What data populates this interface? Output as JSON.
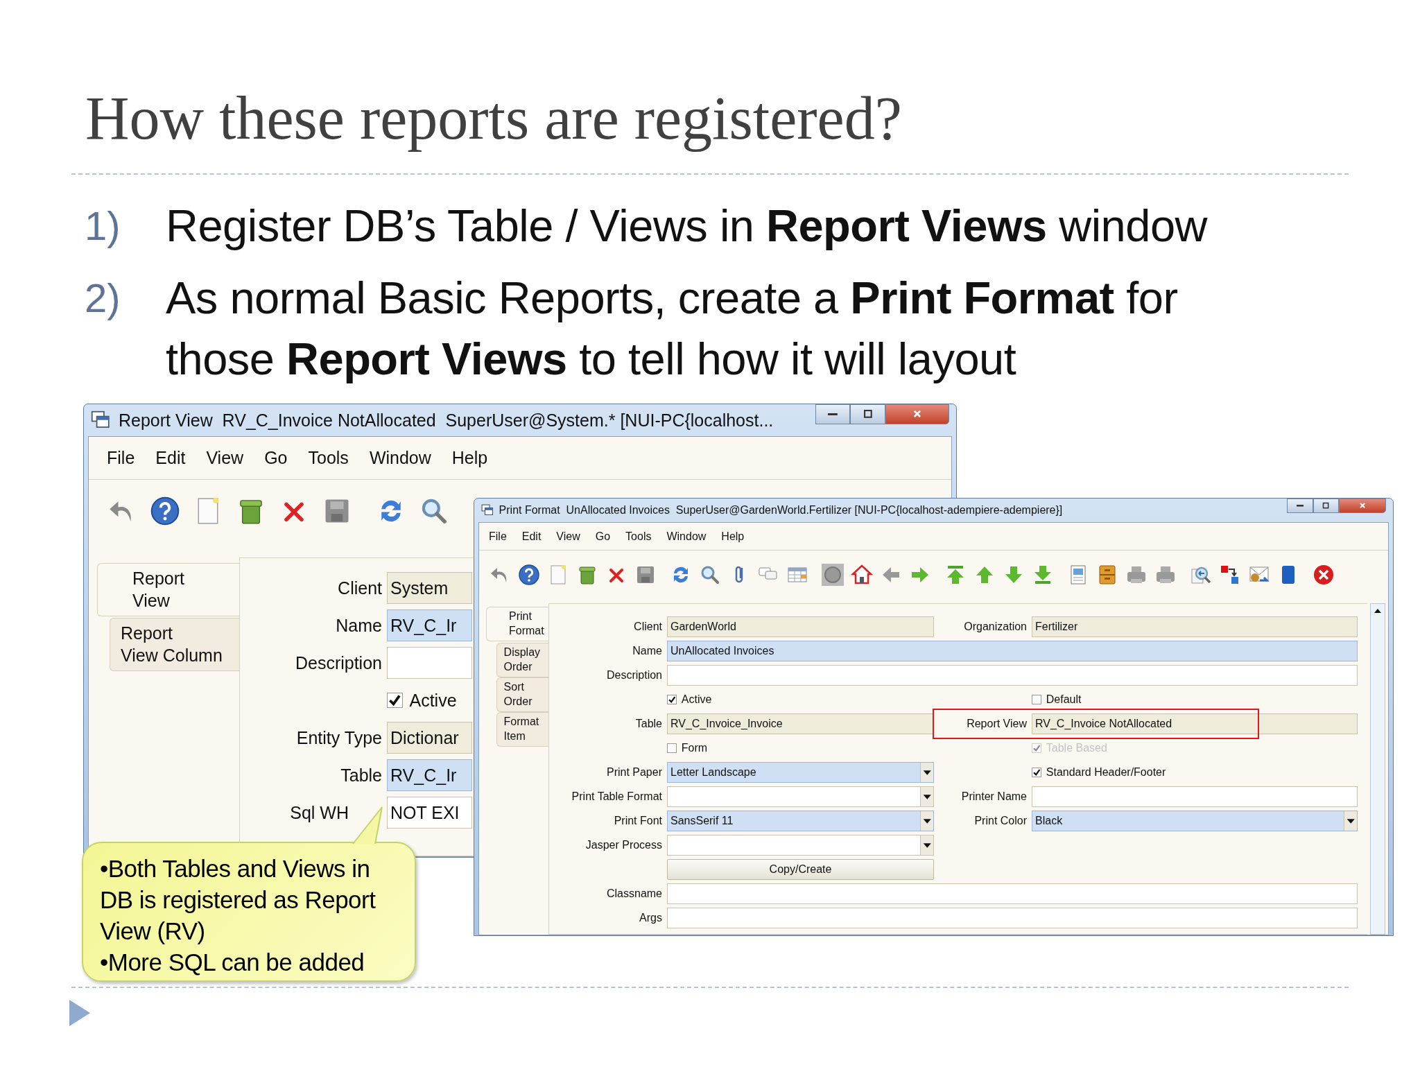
{
  "slide": {
    "title": "How these reports are registered?",
    "points": [
      {
        "number": "1)",
        "text": "Register DB’s Table / Views in **Report Views** window"
      },
      {
        "number": "2)",
        "text": "As normal Basic Reports, create a **Print Format** for those **Report Views** to tell how it will layout"
      }
    ]
  },
  "windows": [
    {
      "title": "Report View  RV_C_Invoice NotAllocated  SuperUser@System.* [NUI-PC{localhost...",
      "menu": [
        "File",
        "Edit",
        "View",
        "Go",
        "Tools",
        "Window",
        "Help"
      ],
      "tabs": [
        {
          "label": "Report\nView",
          "selected": true
        },
        {
          "label": "Report\nView Column",
          "selected": false
        }
      ],
      "rows": [
        [
          {
            "kind": "text",
            "label": "Client",
            "value": "System",
            "readonly": true,
            "mandatory": false
          }
        ],
        [
          {
            "kind": "text",
            "label": "Name",
            "value": "RV_C_Ir",
            "readonly": false,
            "mandatory": true
          }
        ],
        [
          {
            "kind": "text",
            "label": "Description",
            "readonly": false,
            "mandatory": false
          }
        ],
        [
          {
            "kind": "checkbox",
            "label": "Active",
            "checked": true,
            "disabled": false
          }
        ],
        [
          {
            "kind": "text",
            "label": "Entity Type",
            "value": "Dictionar",
            "readonly": true,
            "mandatory": false
          }
        ],
        [
          {
            "kind": "text",
            "label": "Table",
            "value": "RV_C_Ir",
            "readonly": false,
            "mandatory": true
          }
        ],
        [
          {
            "kind": "text",
            "label": "Sql WH",
            "value": "NOT EXI",
            "readonly": false,
            "mandatory": false
          }
        ]
      ]
    },
    {
      "title": "Print Format  UnAllocated Invoices  SuperUser@GardenWorld.Fertilizer [NUI-PC{localhost-adempiere-adempiere}]",
      "menu": [
        "File",
        "Edit",
        "View",
        "Go",
        "Tools",
        "Window",
        "Help"
      ],
      "tabs": [
        {
          "label": "Print\nFormat",
          "selected": true
        },
        {
          "label": "Display\nOrder",
          "selected": false
        },
        {
          "label": "Sort\nOrder",
          "selected": false
        },
        {
          "label": "Format\nItem",
          "selected": false
        }
      ],
      "rows": [
        [
          {
            "kind": "text",
            "label": "Client",
            "value": "GardenWorld",
            "readonly": true,
            "mandatory": false
          },
          {
            "kind": "text",
            "label": "Organization",
            "value": "Fertilizer",
            "readonly": true,
            "mandatory": false
          }
        ],
        [
          {
            "kind": "text",
            "label": "Name",
            "value": "UnAllocated Invoices",
            "readonly": false,
            "mandatory": true,
            "wide": true
          }
        ],
        [
          {
            "kind": "text",
            "label": "Description",
            "readonly": false,
            "mandatory": false,
            "wide": true
          }
        ],
        [
          {
            "kind": "checkbox",
            "label": "Active",
            "checked": true,
            "disabled": false
          },
          {
            "kind": "checkbox",
            "label": "Default",
            "checked": false,
            "disabled": false
          }
        ],
        [
          {
            "kind": "text",
            "label": "Table",
            "value": "RV_C_Invoice_Invoice",
            "readonly": true,
            "mandatory": false
          },
          {
            "kind": "text",
            "label": "Report View",
            "value": "RV_C_Invoice NotAllocated",
            "readonly": true,
            "mandatory": false,
            "highlighted": true
          }
        ],
        [
          {
            "kind": "checkbox",
            "label": "Form",
            "checked": false,
            "disabled": false
          },
          {
            "kind": "checkbox",
            "label": "Table Based",
            "checked": true,
            "disabled": true
          }
        ],
        [
          {
            "kind": "combo",
            "label": "Print Paper",
            "value": "Letter Landscape",
            "readonly": false,
            "mandatory": true
          },
          {
            "kind": "checkbox",
            "label": "Standard Header/Footer",
            "checked": true,
            "disabled": false
          }
        ],
        [
          {
            "kind": "combo",
            "label": "Print Table Format",
            "readonly": false,
            "mandatory": false
          },
          {
            "kind": "text",
            "label": "Printer Name",
            "readonly": false,
            "mandatory": false
          }
        ],
        [
          {
            "kind": "combo",
            "label": "Print Font",
            "value": "SansSerif 11",
            "readonly": false,
            "mandatory": true
          },
          {
            "kind": "combo",
            "label": "Print Color",
            "value": "Black",
            "readonly": false,
            "mandatory": true
          }
        ],
        [
          {
            "kind": "combo",
            "label": "Jasper Process",
            "readonly": false,
            "mandatory": false
          }
        ],
        [
          {
            "kind": "button",
            "label": "Copy/Create"
          }
        ],
        [
          {
            "kind": "text",
            "label": "Classname",
            "readonly": false,
            "mandatory": false,
            "wide": true
          }
        ],
        [
          {
            "kind": "text",
            "label": "Args",
            "readonly": false,
            "mandatory": false,
            "wide": true
          }
        ]
      ]
    }
  ],
  "callout": {
    "lines": [
      "•Both Tables and Views in DB is registered as Report View (RV)",
      "•More SQL can be added"
    ]
  }
}
